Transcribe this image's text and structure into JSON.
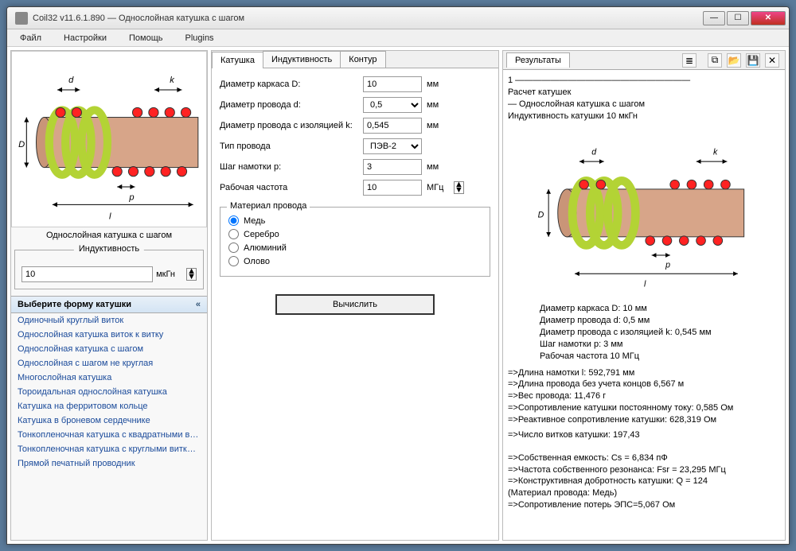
{
  "app": {
    "title": "Coil32 v11.6.1.890 — Однослойная катушка с шагом"
  },
  "menu": [
    "Файл",
    "Настройки",
    "Помощь",
    "Plugins"
  ],
  "diagram_caption": "Однослойная катушка с шагом",
  "inductance": {
    "label": "Индуктивность",
    "value": "10",
    "unit": "мкГн"
  },
  "coil_select": {
    "header": "Выберите форму катушки",
    "items": [
      "Одиночный круглый виток",
      "Однослойная катушка виток к витку",
      "Однослойная катушка с шагом",
      "Однослойная с шагом не круглая",
      "Многослойная катушка",
      "Тороидальная однослойная катушка",
      "Катушка на ферритовом кольце",
      "Катушка в броневом сердечнике",
      "Тонкопленочная катушка с квадратными вит...",
      "Тонкопленочная катушка с круглыми витками",
      "Прямой печатный проводник"
    ]
  },
  "tabs": [
    "Катушка",
    "Индуктивность",
    "Контур"
  ],
  "form": {
    "f1": {
      "label": "Диаметр каркаса D:",
      "value": "10",
      "unit": "мм"
    },
    "f2": {
      "label": "Диаметр провода d:",
      "value": "0,5",
      "unit": "мм"
    },
    "f3": {
      "label": "Диаметр провода с изоляцией k:",
      "value": "0,545",
      "unit": "мм"
    },
    "f4": {
      "label": "Тип провода",
      "value": "ПЭВ-2"
    },
    "f5": {
      "label": "Шаг намотки p:",
      "value": "3",
      "unit": "мм"
    },
    "f6": {
      "label": "Рабочая частота",
      "value": "10",
      "unit": "МГц"
    },
    "material": {
      "legend": "Материал провода",
      "opts": [
        "Медь",
        "Серебро",
        "Алюминий",
        "Олово"
      ]
    },
    "calc": "Вычислить"
  },
  "results": {
    "tab": "Результаты",
    "head": [
      "1 ————————————————————",
      "Расчет катушек",
      "— Однослойная катушка с шагом",
      "   Индуктивность катушки 10 мкГн"
    ],
    "params": [
      "Диаметр каркаса D: 10 мм",
      "Диаметр провода d: 0,5 мм",
      "Диаметр провода с изоляцией k: 0,545 мм",
      "Шаг намотки p: 3 мм",
      "Рабочая частота 10 МГц"
    ],
    "calc": [
      "=>Длина намотки l: 592,791 мм",
      "=>Длина провода без учета концов 6,567 м",
      "=>Вес провода: 11,476 г",
      "=>Сопротивление катушки постоянному току: 0,585 Ом",
      "=>Реактивное сопротивление катушки: 628,319 Ом",
      "=>Число витков катушки: 197,43"
    ],
    "extra": [
      "=>Собственная емкость: Cs = 6,834 пФ",
      "=>Частота собственного резонанса: Fsr = 23,295 МГц",
      "=>Конструктивная добротность катушки: Q = 124",
      "(Материал провода: Медь)",
      "=>Сопротивление потерь ЭПС=5,067 Ом"
    ]
  }
}
